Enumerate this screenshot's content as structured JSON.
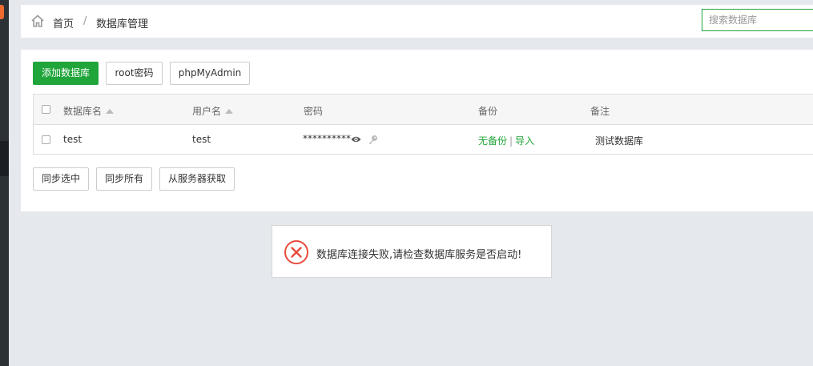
{
  "breadcrumb": {
    "home": "首页",
    "separator": "/",
    "current": "数据库管理"
  },
  "search": {
    "placeholder": "搜索数据库",
    "value": ""
  },
  "toolbar": {
    "add": "添加数据库",
    "root": "root密码",
    "pma": "phpMyAdmin"
  },
  "table": {
    "headers": {
      "name": "数据库名",
      "user": "用户名",
      "password": "密码",
      "backup": "备份",
      "note": "备注"
    },
    "rows": [
      {
        "name": "test",
        "user": "test",
        "password": "**********",
        "backup": "无备份",
        "sep": "|",
        "import": "导入",
        "note": "测试数据库"
      }
    ]
  },
  "bottom": {
    "sync_selected": "同步选中",
    "sync_all": "同步所有",
    "fetch": "从服务器获取"
  },
  "toast": {
    "message": "数据库连接失败,请检查数据库服务是否启动!"
  },
  "icons": [
    "home-icon",
    "eye-icon",
    "key-icon",
    "error-icon"
  ],
  "colors": {
    "accent": "#20a53a",
    "error": "#e84c3d",
    "background": "#e5e8ec"
  }
}
